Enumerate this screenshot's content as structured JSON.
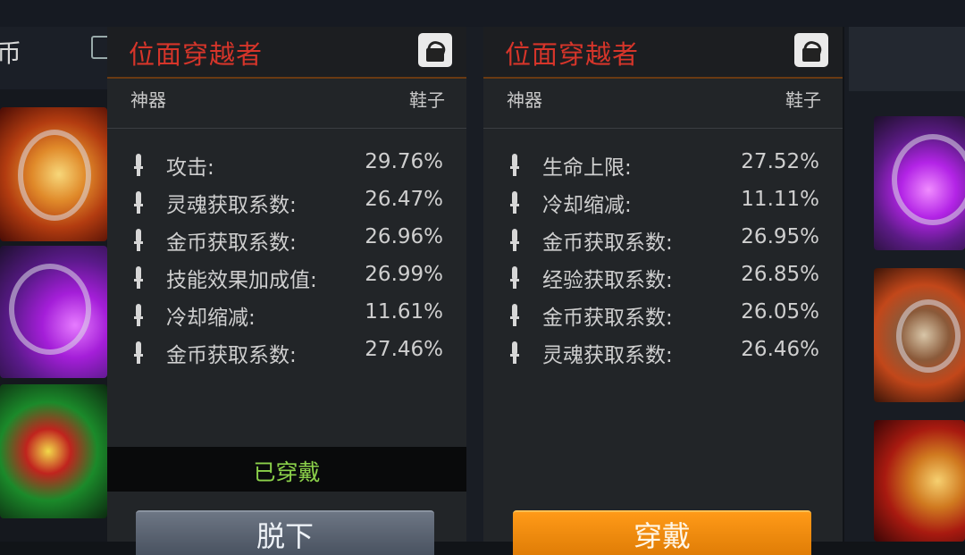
{
  "left_panel": {
    "title": "币"
  },
  "cards": [
    {
      "title": "位面穿越者",
      "category": "神器",
      "slot": "鞋子",
      "stats": [
        {
          "name": "攻击:",
          "value": "29.76%"
        },
        {
          "name": "灵魂获取系数:",
          "value": "26.47%"
        },
        {
          "name": "金币获取系数:",
          "value": "26.96%"
        },
        {
          "name": "技能效果加成值:",
          "value": "26.99%"
        },
        {
          "name": "冷却缩减:",
          "value": "11.61%"
        },
        {
          "name": "金币获取系数:",
          "value": "27.46%"
        }
      ],
      "status": "已穿戴",
      "button": "脱下"
    },
    {
      "title": "位面穿越者",
      "category": "神器",
      "slot": "鞋子",
      "stats": [
        {
          "name": "生命上限:",
          "value": "27.52%"
        },
        {
          "name": "冷却缩减:",
          "value": "11.11%"
        },
        {
          "name": "金币获取系数:",
          "value": "26.95%"
        },
        {
          "name": "经验获取系数:",
          "value": "26.85%"
        },
        {
          "name": "金币获取系数:",
          "value": "26.05%"
        },
        {
          "name": "灵魂获取系数:",
          "value": "26.46%"
        }
      ],
      "button": "穿戴"
    }
  ],
  "colors": {
    "title_red": "#d6352a",
    "equipped_green": "#8bd04a",
    "equip_orange": "#f08c0e",
    "unequip_grey": "#5b6472"
  }
}
